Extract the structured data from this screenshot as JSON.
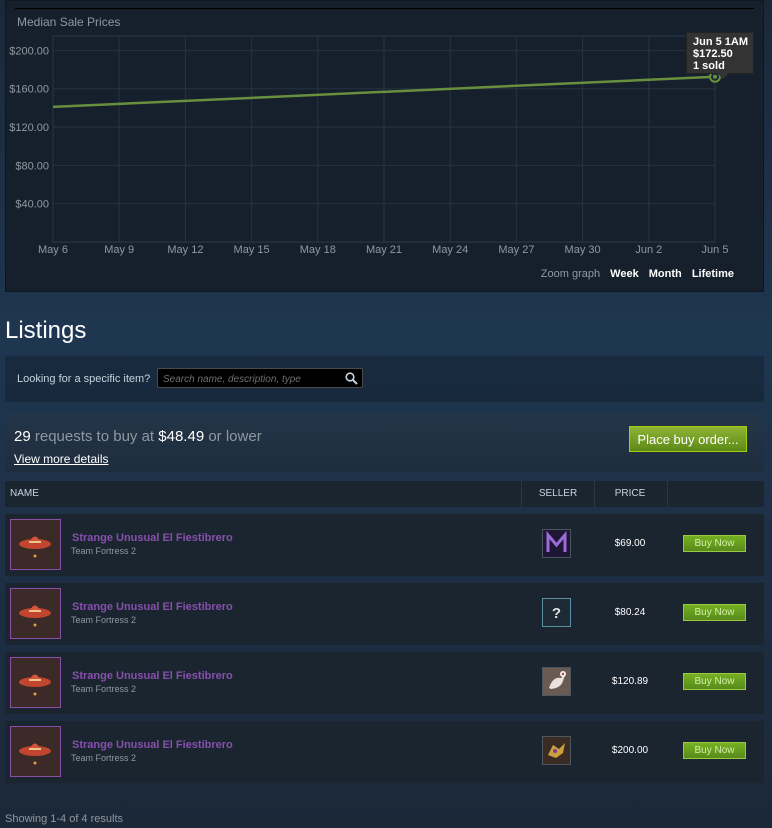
{
  "chart": {
    "title": "Median Sale Prices",
    "tooltip": {
      "date": "Jun 5 1AM",
      "price": "$172.50",
      "sold": "1 sold"
    },
    "zoom": {
      "label": "Zoom graph",
      "options": [
        "Week",
        "Month",
        "Lifetime"
      ]
    }
  },
  "chart_data": {
    "type": "line",
    "title": "Median Sale Prices",
    "x": [
      "May 6",
      "Jun 5"
    ],
    "y": [
      141,
      172.5
    ],
    "xticks": [
      "May 6",
      "May 9",
      "May 12",
      "May 15",
      "May 18",
      "May 21",
      "May 24",
      "May 27",
      "May 30",
      "Jun 2",
      "Jun 5"
    ],
    "yticks": [
      "$200.00",
      "$160.00",
      "$120.00",
      "$80.00",
      "$40.00"
    ],
    "ylim": [
      0,
      215
    ],
    "grid": true,
    "color": "#688f3e"
  },
  "listings": {
    "title": "Listings",
    "search_label": "Looking for a specific item?",
    "search_placeholder": "Search name, description, type"
  },
  "buy_orders": {
    "count": "29",
    "text_mid": "requests to buy at",
    "price": "$48.49",
    "text_end": "or lower",
    "view_more": "View more details",
    "button": "Place buy order..."
  },
  "table": {
    "headers": {
      "name": "Name",
      "seller": "Seller",
      "price": "Price"
    },
    "rows": [
      {
        "name": "Strange Unusual El Fiestibrero",
        "game": "Team Fortress 2",
        "price": "$69.00",
        "button": "Buy Now",
        "seller_icon": "purple-m-avatar"
      },
      {
        "name": "Strange Unusual El Fiestibrero",
        "game": "Team Fortress 2",
        "price": "$80.24",
        "button": "Buy Now",
        "seller_icon": "question-avatar"
      },
      {
        "name": "Strange Unusual El Fiestibrero",
        "game": "Team Fortress 2",
        "price": "$120.89",
        "button": "Buy Now",
        "seller_icon": "bird-avatar"
      },
      {
        "name": "Strange Unusual El Fiestibrero",
        "game": "Team Fortress 2",
        "price": "$200.00",
        "button": "Buy Now",
        "seller_icon": "gold-creature-avatar"
      }
    ]
  },
  "footer": {
    "results": "Showing 1-4 of 4 results"
  },
  "colors": {
    "accent_green": "#8fb336",
    "item_name": "#8650ac",
    "line": "#688f3e"
  }
}
